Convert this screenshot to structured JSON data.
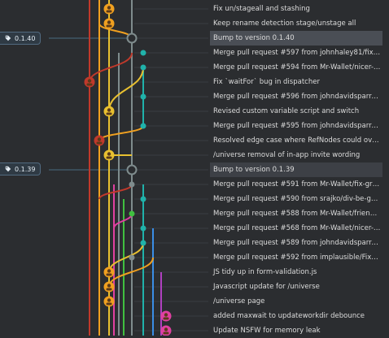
{
  "tags": [
    {
      "label": "0.1.40"
    },
    {
      "label": "0.1.39"
    }
  ],
  "commits": [
    {
      "message": "Fix un/stageall and stashing",
      "state": "normal"
    },
    {
      "message": "Keep rename detection stage/unstage all",
      "state": "normal"
    },
    {
      "message": "Bump to version 0.1.40",
      "state": "selected"
    },
    {
      "message": "Merge pull request #597 from johnhaley81/fix-dispatc…",
      "state": "normal"
    },
    {
      "message": "Merge pull request #594 from Mr-Wallet/nicer-ref-nam…",
      "state": "normal"
    },
    {
      "message": "Fix `waitFor` bug in dispatcher",
      "state": "normal"
    },
    {
      "message": "Merge pull request #596 from johndavidsparrow/gh-p…",
      "state": "normal"
    },
    {
      "message": "Revised custom variable script and switch",
      "state": "normal"
    },
    {
      "message": "Merge pull request #595 from johndavidsparrow/gh-p…",
      "state": "normal"
    },
    {
      "message": "Resolved edge case where RefNodes could overlap",
      "state": "normal"
    },
    {
      "message": "/universe removal of in-app invite wording",
      "state": "normal"
    },
    {
      "message": "Bump to version 0.1.39",
      "state": "tagged"
    },
    {
      "message": "Merge pull request #591 from Mr-Wallet/fix-graph-ref-…",
      "state": "normal"
    },
    {
      "message": "Merge pull request #590 from srajko/div-be-gone",
      "state": "normal"
    },
    {
      "message": "Merge pull request #588 from Mr-Wallet/friendlier-app…",
      "state": "normal"
    },
    {
      "message": "Merge pull request #568 from Mr-Wallet/nicer-ref-nam…",
      "state": "normal"
    },
    {
      "message": "Merge pull request #589 from johndavidsparrow/gh-p…",
      "state": "normal"
    },
    {
      "message": "Merge pull request #592 from implausible/FixNSFW",
      "state": "normal"
    },
    {
      "message": "JS tidy up in form-validation.js",
      "state": "normal"
    },
    {
      "message": "Javascript update for /universe",
      "state": "normal"
    },
    {
      "message": "/universe page",
      "state": "normal"
    },
    {
      "message": "added maxwait to updateworkdir debounce",
      "state": "normal"
    },
    {
      "message": "Update NSFW for memory leak",
      "state": "normal"
    }
  ],
  "colors": {
    "background": "#2b2d30",
    "selected_row": "#4a4e55",
    "lane_orange": "#f0a020",
    "lane_yellow": "#e8c030",
    "lane_red": "#c0392b",
    "lane_teal": "#20b2aa",
    "lane_green": "#40c040",
    "lane_blue": "#3a8ee6",
    "lane_purple": "#b040c0",
    "lane_pink": "#e040a0",
    "lane_grey": "#7f8c8d",
    "tag_line": "#4a6a80"
  }
}
